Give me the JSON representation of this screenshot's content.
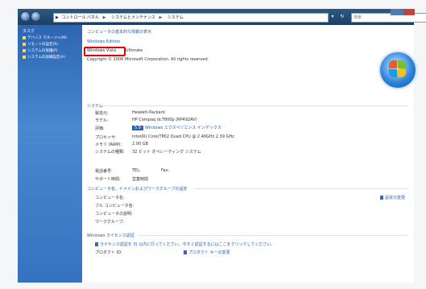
{
  "addressbar": {
    "crumbs": [
      "コントロール パネル",
      "システムとメンテナンス",
      "システム"
    ]
  },
  "search": {
    "placeholder": "検索"
  },
  "sidebar": {
    "title": "タスク",
    "items": [
      {
        "label": "デバイス マネージャ(M)"
      },
      {
        "label": "リモートの設定(R)"
      },
      {
        "label": "システムの保護(P)"
      },
      {
        "label": "システムの詳細設定(A)"
      }
    ]
  },
  "main": {
    "title": "コンピュータの基本的な情報の表示",
    "edition_header": "Windows Edition",
    "edition_name": "Windows Vista",
    "edition_suffix": "Ultimate",
    "copyright": "Copyright © 2006 Microsoft Corporation.  All rights reserved.",
    "system_header": "システム",
    "system_rows": [
      {
        "label": "製造元:",
        "value": "Hewlett-Packard"
      },
      {
        "label": "モデル:",
        "value": "HP Compaq dc7800p (RP492AV)"
      },
      {
        "label": "評価:",
        "badge": "5.9",
        "value": "Windows エクスペリエンス インデックス"
      },
      {
        "label": "プロセッサ:",
        "value": "Intel(R) Core(TM)2 Quad CPU      @ 2.40GHz  2.39 GHz"
      },
      {
        "label": "メモリ (RAM):",
        "value": "2.00 GB"
      },
      {
        "label": "システムの種類:",
        "value": "32 ビット オペレーティング システム"
      }
    ],
    "support_rows": [
      {
        "label": "電話番号:",
        "value": "TEL:",
        "value2": "Fax:"
      },
      {
        "label": "サポート時間:",
        "value": "営業時間"
      }
    ],
    "computer_header": "コンピュータ名、ドメインおよびワークグループの設定",
    "computer_rows": [
      {
        "label": "コンピュータ名:"
      },
      {
        "label": "フル コンピュータ名:"
      },
      {
        "label": "コンピュータの説明:"
      },
      {
        "label": "ワークグループ:"
      }
    ],
    "change_settings": "設定の変更",
    "license_header": "Windows ライセンス認証",
    "license_text": "ライセンス認証を 日 以内に行ってください。今すぐ認証するにはここをクリックしてください。",
    "product_id_label": "プロダクト ID:",
    "product_key_link": "プロダクト キーの変更"
  }
}
